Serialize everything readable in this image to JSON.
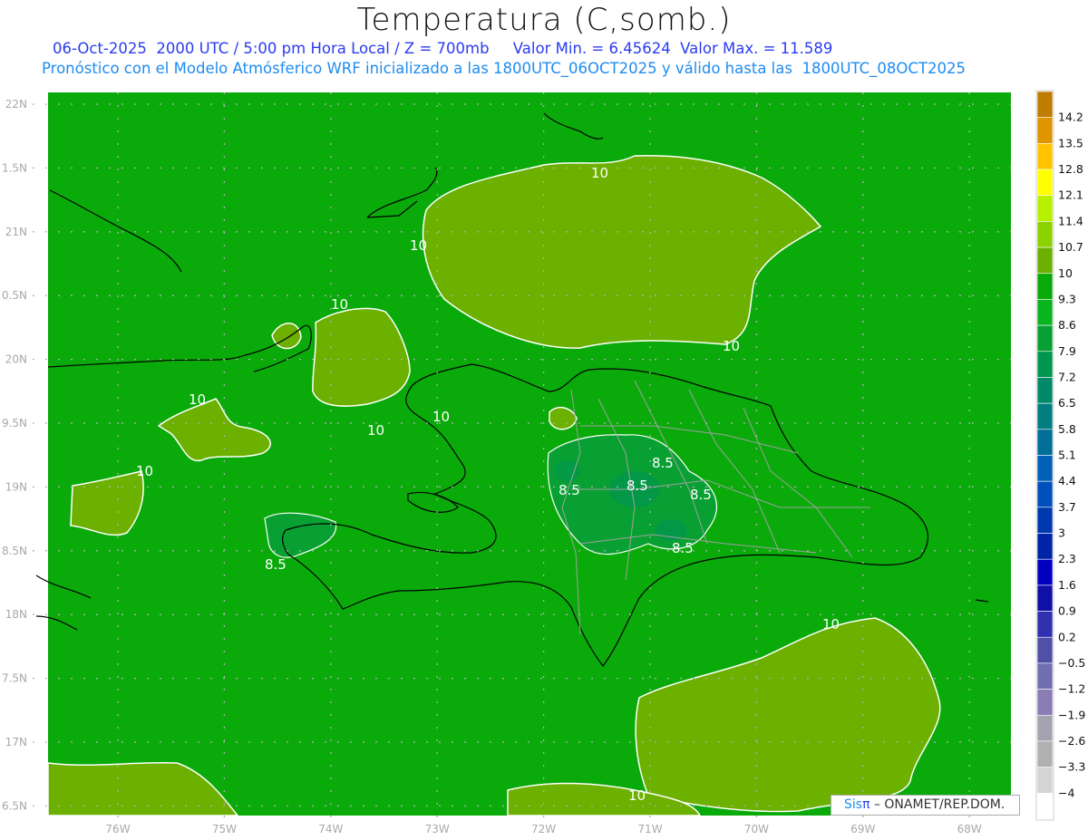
{
  "title": "Temperatura (C,somb.)",
  "subtitle_line1": "06-Oct-2025  2000 UTC / 5:00 pm Hora Local / Z = 700mb     Valor Min. = 6.45624  Valor Max. = 11.589",
  "subtitle_line2": "Pronóstico con el Modelo Atmósferico WRF inicializado a las 1800UTC_06OCT2025 y válido hasta las  1800UTC_08OCT2025",
  "variable": "Temperatura",
  "units": "C",
  "level": "700mb",
  "value_min": 6.45624,
  "value_max": 11.589,
  "lat_labels": [
    "22N",
    "1.5N",
    "21N",
    "0.5N",
    "20N",
    "9.5N",
    "19N",
    "8.5N",
    "18N",
    "7.5N",
    "17N",
    "6.5N"
  ],
  "lon_labels": [
    "76W",
    "75W",
    "74W",
    "73W",
    "72W",
    "71W",
    "70W",
    "69W",
    "68W"
  ],
  "contour_labels": {
    "c10": "10",
    "c85": "8.5"
  },
  "colorbar": {
    "labels": [
      "14.2",
      "13.5",
      "12.8",
      "12.1",
      "11.4",
      "10.7",
      "10",
      "9.3",
      "8.6",
      "7.9",
      "7.2",
      "6.5",
      "5.8",
      "5.1",
      "4.4",
      "3.7",
      "3",
      "2.3",
      "1.6",
      "0.9",
      "0.2",
      "−0.5",
      "−1.2",
      "−1.9",
      "−2.6",
      "−3.3",
      "−4"
    ],
    "colors": [
      "#c07c00",
      "#e09400",
      "#ffc400",
      "#ffff00",
      "#b8f000",
      "#8cd200",
      "#6cb000",
      "#0aaa0a",
      "#0ab41e",
      "#08a032",
      "#009650",
      "#008a6a",
      "#007e80",
      "#006e98",
      "#0060b4",
      "#0050bc",
      "#0038b0",
      "#0024a8",
      "#0000c0",
      "#1010a8",
      "#3030b0",
      "#5050a8",
      "#7070b0",
      "#8c7cb4",
      "#a4a4b0",
      "#b0b0b0",
      "#d4d4d4",
      "#ffffff"
    ]
  },
  "colors": {
    "background_field": "#0aaa0a",
    "warm_field": "#6cb000",
    "cool_field": "#08a032"
  },
  "credit": {
    "brand": "Sis",
    "brand_symbol": "π",
    "text": " –  ONAMET/REP.DOM."
  }
}
